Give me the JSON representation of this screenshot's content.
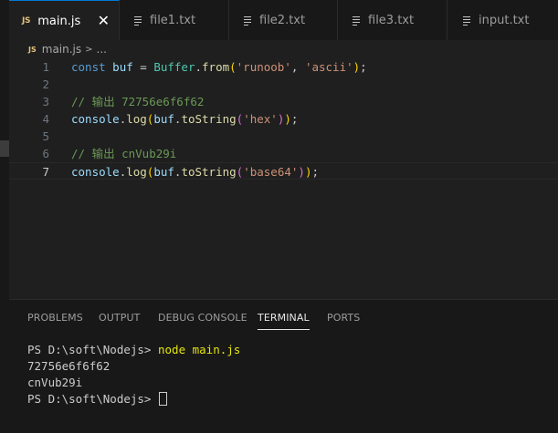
{
  "tabs": [
    {
      "label": "main.js",
      "badge": "JS",
      "close": "✕"
    },
    {
      "label": "file1.txt"
    },
    {
      "label": "file2.txt"
    },
    {
      "label": "file3.txt"
    },
    {
      "label": "input.txt"
    }
  ],
  "breadcrumb": {
    "badge": "JS",
    "file": "main.js",
    "separator": ">",
    "more": "..."
  },
  "editor": {
    "line_numbers": [
      "1",
      "2",
      "3",
      "4",
      "5",
      "6",
      "7"
    ],
    "l1": {
      "kw": "const",
      "var": "buf",
      "eq": " = ",
      "cls": "Buffer",
      "dot": ".",
      "fn": "from",
      "open": "(",
      "s1": "'runoob'",
      "comma": ", ",
      "s2": "'ascii'",
      "close": ");"
    },
    "l3": {
      "comment": "// 输出 72756e6f6f62"
    },
    "l4": {
      "obj": "console",
      "dot": ".",
      "fn": "log",
      "open1": "(",
      "var": "buf",
      "dot2": ".",
      "fn2": "toString",
      "open2": "(",
      "str": "'hex'",
      "close2": ")",
      "close1": ")",
      "semi": ";"
    },
    "l6": {
      "comment": "// 输出 cnVub29i"
    },
    "l7": {
      "obj": "console",
      "dot": ".",
      "fn": "log",
      "open1": "(",
      "var": "buf",
      "dot2": ".",
      "fn2": "toString",
      "open2": "(",
      "str": "'base64'",
      "close2": ")",
      "close1": ")",
      "semi": ";"
    }
  },
  "panel": {
    "tabs": [
      "PROBLEMS",
      "OUTPUT",
      "DEBUG CONSOLE",
      "TERMINAL",
      "PORTS"
    ],
    "active_tab": "TERMINAL"
  },
  "terminal": {
    "prompt": "PS D:\\soft\\Nodejs> ",
    "command": "node main.js",
    "output1": "72756e6f6f62",
    "output2": "cnVub29i",
    "prompt2": "PS D:\\soft\\Nodejs> "
  },
  "colors": {
    "accent": "#0078d4",
    "background": "#1f1f1f",
    "sidebar": "#181818"
  }
}
